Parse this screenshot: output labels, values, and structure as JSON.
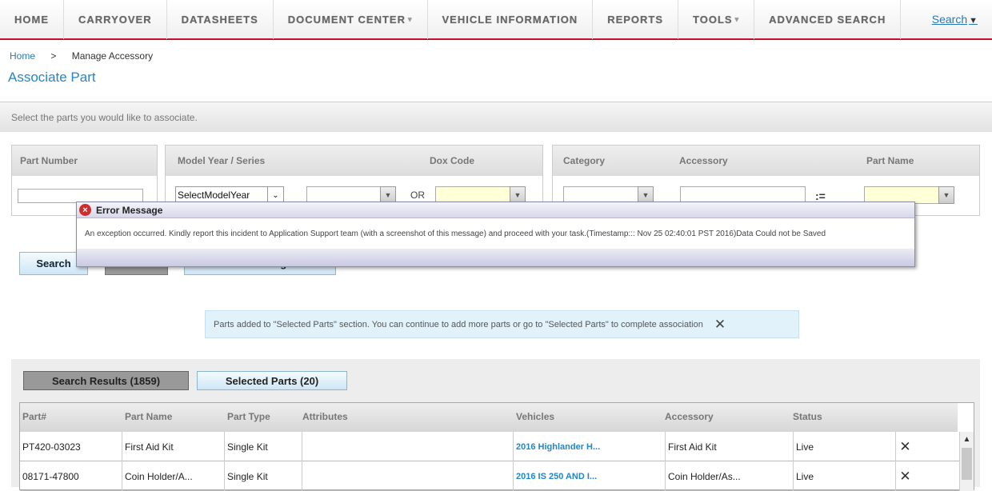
{
  "nav": {
    "items": [
      {
        "label": "HOME",
        "caret": false
      },
      {
        "label": "CARRYOVER",
        "caret": false
      },
      {
        "label": "DATASHEETS",
        "caret": false
      },
      {
        "label": "DOCUMENT CENTER",
        "caret": true
      },
      {
        "label": "VEHICLE INFORMATION",
        "caret": false
      },
      {
        "label": "REPORTS",
        "caret": false
      },
      {
        "label": "TOOLS",
        "caret": true
      },
      {
        "label": "ADVANCED SEARCH",
        "caret": false
      }
    ],
    "search_label": "Search"
  },
  "breadcrumb": {
    "home": "Home",
    "separator": ">",
    "current": "Manage Accessory"
  },
  "page_title": "Associate Part",
  "instructions": "Select the parts you would like to associate.",
  "filters": {
    "part_number_label": "Part Number",
    "model_year_series_label": "Model Year / Series",
    "dox_code_label": "Dox Code",
    "model_year_select_value": "SelectModelYear",
    "or_label": "OR",
    "category_label": "Category",
    "accessory_label": "Accessory",
    "part_name_label": "Part Name",
    "list_icon": ":="
  },
  "buttons": {
    "search": "Search",
    "reset": "Reset",
    "return": "Return to Manage Part"
  },
  "error_modal": {
    "title": "Error Message",
    "message": "An exception occurred. Kindly report this incident to Application Support team (with a screenshot of this message) and proceed with your task.(Timestamp::: Nov 25 02:40:01 PST 2016)Data Could not be Saved"
  },
  "notice": {
    "text": "Parts added to \"Selected Parts\" section. You can continue to add more parts or go to \"Selected Parts\" to complete association"
  },
  "results": {
    "tabs": {
      "search_results": "Search Results (1859)",
      "selected_parts": "Selected Parts (20)"
    },
    "columns": [
      "Part#",
      "Part Name",
      "Part Type",
      "Attributes",
      "Vehicles",
      "Accessory",
      "Status"
    ],
    "rows": [
      {
        "part": "PT420-03023",
        "name": "First Aid Kit",
        "type": "Single Kit",
        "attributes": "",
        "vehicles": "2016 Highlander H...",
        "accessory": "First Aid Kit",
        "status": "Live"
      },
      {
        "part": "08171-47800",
        "name": "Coin Holder/A...",
        "type": "Single Kit",
        "attributes": "",
        "vehicles": "2016 IS 250 AND I...",
        "accessory": "Coin Holder/As...",
        "status": "Live"
      }
    ]
  },
  "colors": {
    "accent": "#2586c7",
    "nav_border": "#c8102e",
    "error": "#d32a2a"
  }
}
